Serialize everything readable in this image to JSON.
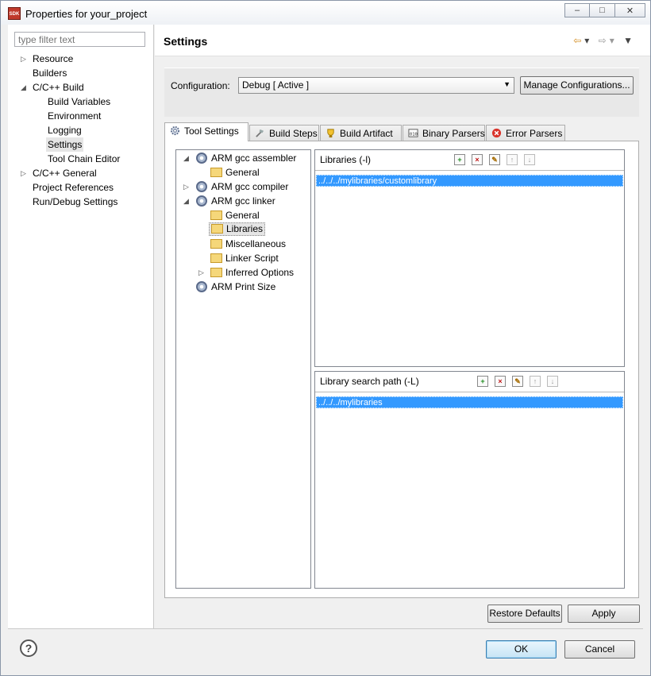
{
  "window": {
    "title": "Properties for your_project",
    "icon_text": "SDK",
    "minimize": "‒",
    "maximize": "□",
    "close": "✕"
  },
  "left": {
    "filter_placeholder": "type filter text",
    "tree": [
      {
        "label": "Resource",
        "arrow": "▷"
      },
      {
        "label": "Builders",
        "arrow": ""
      },
      {
        "label": "C/C++ Build",
        "arrow": "◢"
      },
      {
        "label": "Build Variables",
        "arrow": ""
      },
      {
        "label": "Environment",
        "arrow": ""
      },
      {
        "label": "Logging",
        "arrow": ""
      },
      {
        "label": "Settings",
        "arrow": "",
        "selected": true
      },
      {
        "label": "Tool Chain Editor",
        "arrow": ""
      },
      {
        "label": "C/C++ General",
        "arrow": "▷"
      },
      {
        "label": "Project References",
        "arrow": ""
      },
      {
        "label": "Run/Debug Settings",
        "arrow": ""
      }
    ]
  },
  "header": {
    "title": "Settings",
    "nav_back": "⇦",
    "nav_fwd": "⇨",
    "dropdown": "▾",
    "menu": "▼"
  },
  "config": {
    "label": "Configuration:",
    "value": "Debug  [ Active ]",
    "manage_label": "Manage Configurations..."
  },
  "tabs": [
    {
      "label": "Tool Settings",
      "icon": "gear-icon",
      "active": true
    },
    {
      "label": "Build Steps",
      "icon": "hammer-icon",
      "active": false
    },
    {
      "label": "Build Artifact",
      "icon": "trophy-icon",
      "active": false
    },
    {
      "label": "Binary Parsers",
      "icon": "binary-icon",
      "active": false
    },
    {
      "label": "Error Parsers",
      "icon": "error-icon",
      "active": false
    }
  ],
  "tools": {
    "items": [
      {
        "label": "ARM gcc assembler",
        "arrow": "◢",
        "kind": "gear"
      },
      {
        "label": "General",
        "arrow": "",
        "kind": "folder"
      },
      {
        "label": "ARM gcc compiler",
        "arrow": "▷",
        "kind": "gear"
      },
      {
        "label": "ARM gcc linker",
        "arrow": "◢",
        "kind": "gear"
      },
      {
        "label": "General",
        "arrow": "",
        "kind": "folder"
      },
      {
        "label": "Libraries",
        "arrow": "",
        "kind": "folder",
        "selected": true
      },
      {
        "label": "Miscellaneous",
        "arrow": "",
        "kind": "folder"
      },
      {
        "label": "Linker Script",
        "arrow": "",
        "kind": "folder"
      },
      {
        "label": "Inferred Options",
        "arrow": "▷",
        "kind": "folder"
      },
      {
        "label": "ARM Print Size",
        "arrow": "",
        "kind": "gear"
      }
    ]
  },
  "libraries": {
    "title": "Libraries (-l)",
    "items": [
      "../../../mylibraries/customlibrary"
    ]
  },
  "search_path": {
    "title": "Library search path (-L)",
    "items": [
      "../../../mylibraries"
    ]
  },
  "buttons": {
    "restore": "Restore Defaults",
    "apply": "Apply",
    "ok": "OK",
    "cancel": "Cancel",
    "help": "?"
  }
}
